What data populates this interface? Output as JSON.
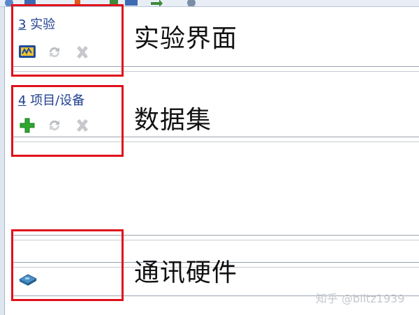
{
  "sections": [
    {
      "num": "3",
      "title": "实验",
      "annotation": "实验界面",
      "icons": [
        "experiment-window-icon",
        "refresh-icon",
        "delete-icon"
      ]
    },
    {
      "num": "4",
      "title": "项目/设备",
      "annotation": "数据集",
      "icons": [
        "add-icon",
        "refresh-icon",
        "delete-icon"
      ]
    },
    {
      "annotation": "通讯硬件",
      "icons": [
        "hardware-icon"
      ]
    }
  ],
  "colors": {
    "highlight_box": "#e0111b",
    "section_title": "#1e3f8f"
  },
  "watermark": "知乎 @blitz1939"
}
